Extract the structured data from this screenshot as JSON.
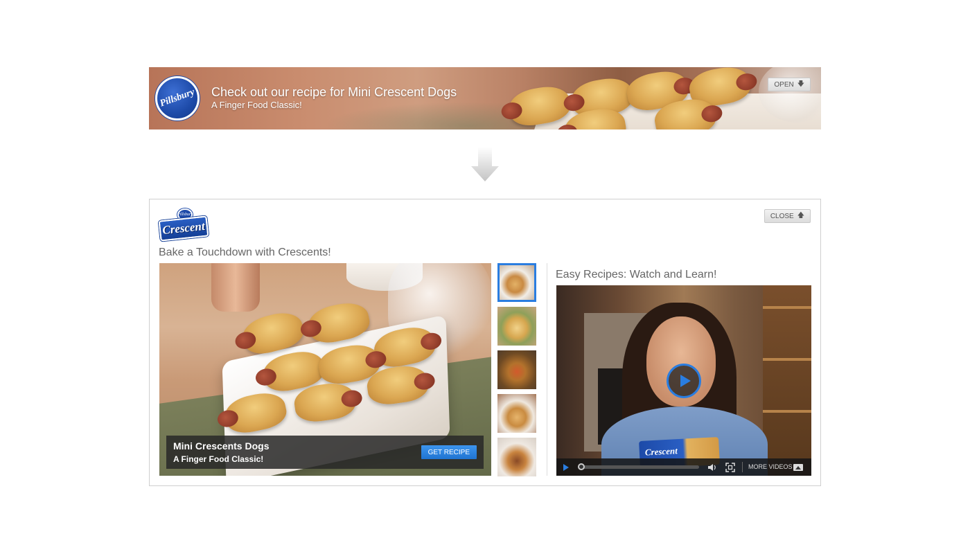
{
  "banner": {
    "logo_text": "Pillsbury",
    "title": "Check out our recipe for Mini Crescent Dogs",
    "subtitle": "A Finger Food Classic!",
    "open_label": "OPEN",
    "open_icon": "arrow-down-icon"
  },
  "transition_icon": "big-arrow-down-icon",
  "panel": {
    "logo_badge": "Pillsbury",
    "logo_text": "Crescent",
    "close_label": "CLOSE",
    "close_icon": "arrow-up-icon",
    "heading": "Bake a Touchdown with Crescents!",
    "feature": {
      "title": "Mini Crescents Dogs",
      "subtitle": "A Finger Food Classic!",
      "button_label": "GET RECIPE"
    },
    "thumbnails": [
      {
        "name": "mini-crescent-dogs",
        "selected": true
      },
      {
        "name": "crescent-pouch",
        "selected": false
      },
      {
        "name": "crescent-pizza-squares",
        "selected": false
      },
      {
        "name": "crescent-pinwheels",
        "selected": false
      },
      {
        "name": "crescent-bars",
        "selected": false
      }
    ],
    "video": {
      "heading": "Easy Recipes: Watch and Learn!",
      "package_text": "Crescent",
      "more_videos_label": "MORE VIDEOS",
      "progress": 0
    }
  },
  "colors": {
    "accent_blue": "#2a7de0",
    "brand_blue": "#1d4aa8"
  }
}
